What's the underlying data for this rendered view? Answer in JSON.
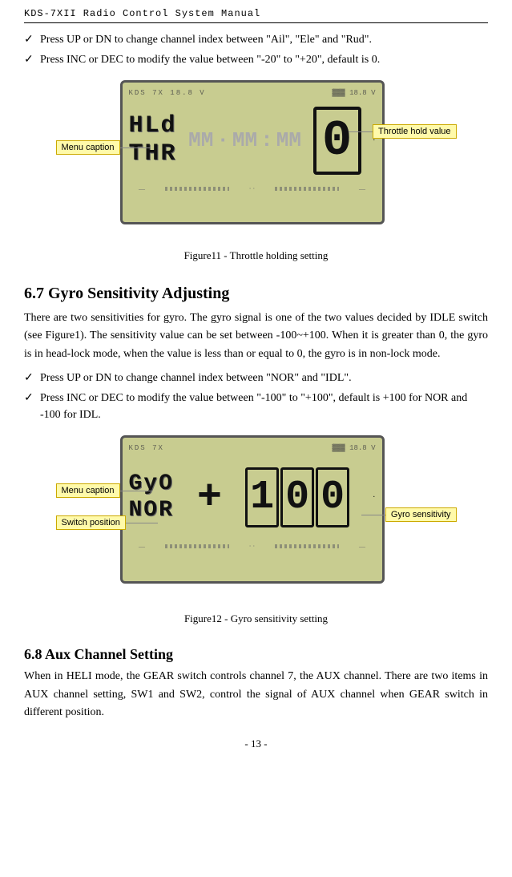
{
  "page": {
    "title": "KDS-7XII Radio Control System Manual",
    "page_number": "- 13 -"
  },
  "section67": {
    "heading": "6.7 Gyro Sensitivity Adjusting",
    "body1": "There are two sensitivities for gyro. The gyro signal is one of the two values decided by IDLE switch (see Figure1). The sensitivity value can be set between -100~+100. When it is greater than 0, the gyro is in head-lock mode, when the value is less than or equal to 0, the gyro is in non-lock mode.",
    "bullets": [
      "Press UP or DN to change channel index between \"NOR\" and \"IDL\".",
      "Press INC or DEC to modify the value between \"-100\" to \"+100\", default is +100 for NOR and -100 for IDL."
    ]
  },
  "section68": {
    "heading": "6.8 Aux Channel Setting",
    "body1": "When in HELI mode, the GEAR switch controls channel 7, the AUX channel. There are two items in AUX channel setting, SW1 and SW2, control the signal of AUX channel when GEAR switch in different position."
  },
  "bullets_before_fig11": [
    "Press UP or DN to change channel index between \"Ail\", \"Ele\" and \"Rud\".",
    "Press INC or DEC to modify the value between \"-20\" to \"+20\", default is 0."
  ],
  "fig11": {
    "caption": "Figure11 - Throttle holding setting",
    "lcd_top": "KDS 7X        18.8 V",
    "lcd_left_line1": "HLd",
    "lcd_left_line2": "THR",
    "lcd_value": "0",
    "label_menu_caption": "Menu caption",
    "label_throttle_hold": "Throttle hold value"
  },
  "fig12": {
    "caption": "Figure12 - Gyro sensitivity setting",
    "lcd_top": "KDS 7X        18.8 V",
    "lcd_left_line1": "GyO",
    "lcd_left_line2": "NOR",
    "lcd_value": "100",
    "lcd_cross": "+",
    "label_menu_caption": "Menu caption",
    "label_switch_position": "Switch position",
    "label_gyro_sensitivity": "Gyro sensitivity"
  }
}
